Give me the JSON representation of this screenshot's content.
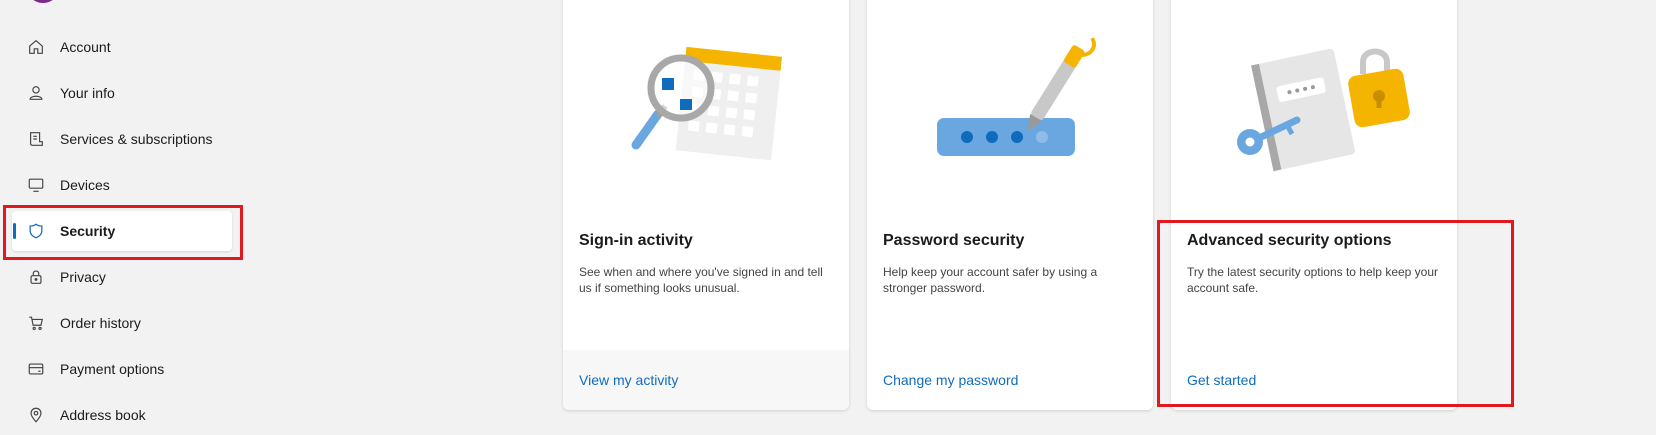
{
  "sidebar": {
    "items": [
      {
        "label": "Account",
        "icon": "home-icon"
      },
      {
        "label": "Your info",
        "icon": "person-icon"
      },
      {
        "label": "Services & subscriptions",
        "icon": "receipt-icon"
      },
      {
        "label": "Devices",
        "icon": "monitor-icon"
      },
      {
        "label": "Security",
        "icon": "shield-icon",
        "active": true
      },
      {
        "label": "Privacy",
        "icon": "lock-icon"
      },
      {
        "label": "Order history",
        "icon": "cart-icon"
      },
      {
        "label": "Payment options",
        "icon": "credit-card-icon"
      },
      {
        "label": "Address book",
        "icon": "location-pin-icon"
      }
    ]
  },
  "cards": [
    {
      "title": "Sign-in activity",
      "description": "See when and where you've signed in and tell us if something looks unusual.",
      "link": "View my activity",
      "illustration": "calendar-magnifier-illustration"
    },
    {
      "title": "Password security",
      "description": "Help keep your account safer by using a stronger password.",
      "link": "Change my password",
      "illustration": "password-pen-illustration"
    },
    {
      "title": "Advanced security options",
      "description": "Try the latest security options to help keep your account safe.",
      "link": "Get started",
      "illustration": "key-lock-illustration"
    }
  ],
  "colors": {
    "accent": "#0f6cbd",
    "highlight": "#e0191f",
    "background": "#f2f2f2"
  }
}
